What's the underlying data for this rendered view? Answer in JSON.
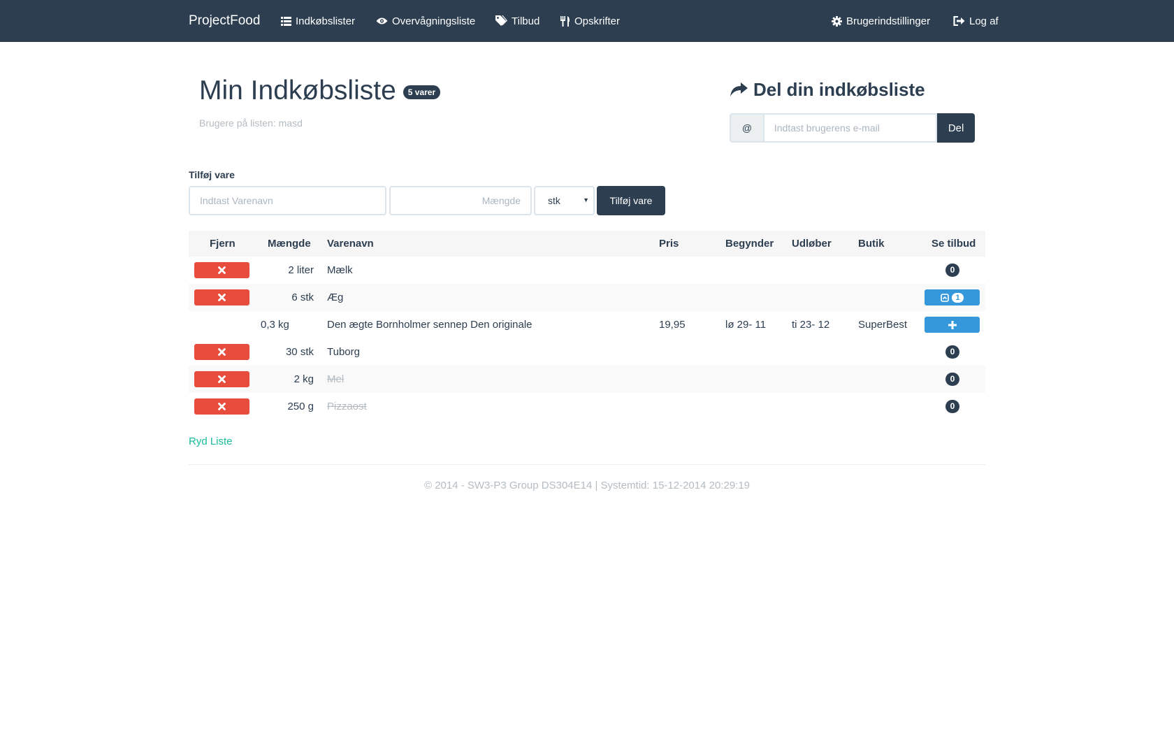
{
  "navbar": {
    "brand": "ProjectFood",
    "items": [
      {
        "label": "Indkøbslister",
        "icon": "list-icon"
      },
      {
        "label": "Overvågningsliste",
        "icon": "eye-icon"
      },
      {
        "label": "Tilbud",
        "icon": "tags-icon"
      },
      {
        "label": "Opskrifter",
        "icon": "cutlery-icon"
      }
    ],
    "right": [
      {
        "label": "Brugerindstillinger",
        "icon": "gear-icon"
      },
      {
        "label": "Log af",
        "icon": "logout-icon"
      }
    ]
  },
  "header": {
    "title": "Min Indkøbsliste",
    "badge": "5 varer",
    "users_text": "Brugere på listen: masd"
  },
  "share": {
    "title": "Del din indkøbsliste",
    "icon": "share-icon",
    "addon": "@",
    "placeholder": "Indtast brugerens e-mail",
    "button": "Del"
  },
  "add_item": {
    "label": "Tilføj vare",
    "name_placeholder": "Indtast Varenavn",
    "qty_placeholder": "Mængde",
    "unit_selected": "stk",
    "button": "Tilføj vare"
  },
  "table": {
    "headers": {
      "remove": "Fjern",
      "qty": "Mængde",
      "name": "Varenavn",
      "price": "Pris",
      "start": "Begynder",
      "end": "Udløber",
      "shop": "Butik",
      "offers": "Se tilbud"
    },
    "rows": [
      {
        "qty": "2 liter",
        "name": "Mælk",
        "price": "",
        "start": "",
        "end": "",
        "shop": "",
        "offers": "0"
      },
      {
        "qty": "6 stk",
        "name": "Æg",
        "price": "",
        "start": "",
        "end": "",
        "shop": "",
        "offers": "1"
      },
      {
        "qty": "0,3 kg",
        "name": "Den ægte Bornholmer sennep Den originale",
        "price": "19,95",
        "start": "lø 29- 11",
        "end": "ti 23- 12",
        "shop": "SuperBest",
        "offers": ""
      },
      {
        "qty": "30 stk",
        "name": "Tuborg",
        "price": "",
        "start": "",
        "end": "",
        "shop": "",
        "offers": "0"
      },
      {
        "qty": "2 kg",
        "name": "Mel",
        "price": "",
        "start": "",
        "end": "",
        "shop": "",
        "offers": "0"
      },
      {
        "qty": "250 g",
        "name": "Pizzaost",
        "price": "",
        "start": "",
        "end": "",
        "shop": "",
        "offers": "0"
      }
    ]
  },
  "clear_link": "Ryd Liste",
  "footer": "© 2014 - SW3-P3 Group DS304E14 | Systemtid: 15-12-2014 20:29:19",
  "colors": {
    "navbar": "#2c3e50",
    "danger": "#e74c3c",
    "info": "#3498db",
    "success": "#18bc9c",
    "muted": "#b4bcc2"
  }
}
